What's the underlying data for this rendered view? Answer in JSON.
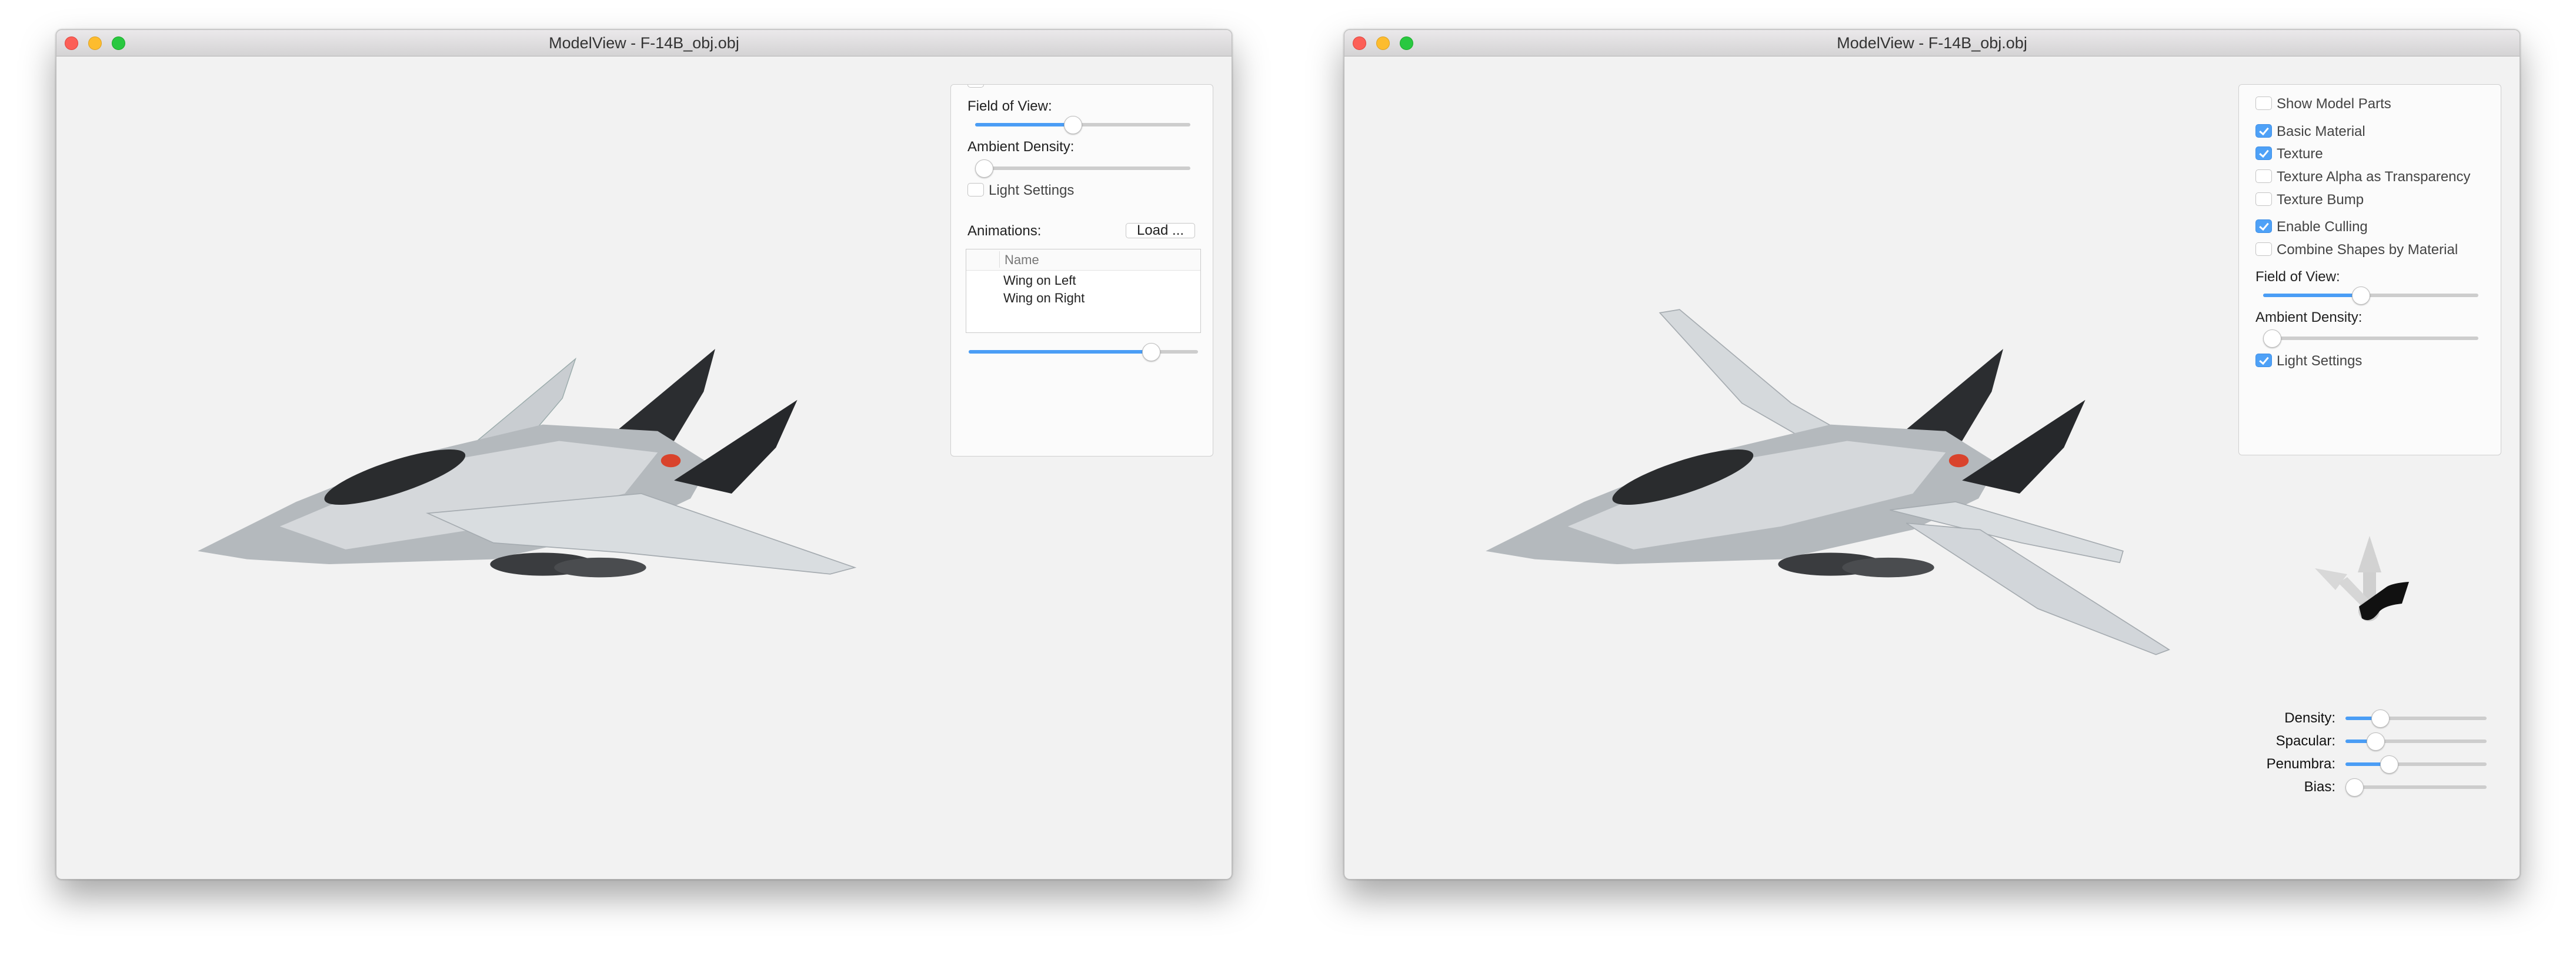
{
  "colors": {
    "accent": "#4a9df5",
    "close": "#fc5f57",
    "minimize": "#fdbc2e",
    "maximize": "#29c840"
  },
  "left_window": {
    "title": "ModelView - F-14B_obj.obj",
    "panel": {
      "fov_label": "Field of View:",
      "fov_value": 0.45,
      "ambient_label": "Ambient Density:",
      "ambient_value": 0.0,
      "light_settings": {
        "label": "Light Settings",
        "checked": false
      },
      "animations_label": "Animations:",
      "load_button": "Load ...",
      "table": {
        "header": "Name",
        "rows": [
          "Wing on Left",
          "Wing on Right"
        ]
      },
      "animation_slider_value": 0.82
    }
  },
  "right_window": {
    "title": "ModelView - F-14B_obj.obj",
    "panel": {
      "checkboxes": [
        {
          "label": "Show Model Parts",
          "checked": false
        },
        {
          "label": "Basic Material",
          "checked": true
        },
        {
          "label": "Texture",
          "checked": true
        },
        {
          "label": "Texture Alpha as Transparency",
          "checked": false
        },
        {
          "label": "Texture Bump",
          "checked": false
        },
        {
          "label": "Enable Culling",
          "checked": true
        },
        {
          "label": "Combine Shapes by Material",
          "checked": false
        }
      ],
      "fov_label": "Field of View:",
      "fov_value": 0.45,
      "ambient_label": "Ambient Density:",
      "ambient_value": 0.0,
      "light_settings": {
        "label": "Light Settings",
        "checked": true
      }
    },
    "light_sliders": [
      {
        "label": "Density:",
        "value": 0.21
      },
      {
        "label": "Spacular:",
        "value": 0.17
      },
      {
        "label": "Penumbra:",
        "value": 0.28
      },
      {
        "label": "Bias:",
        "value": 0.0
      }
    ]
  }
}
